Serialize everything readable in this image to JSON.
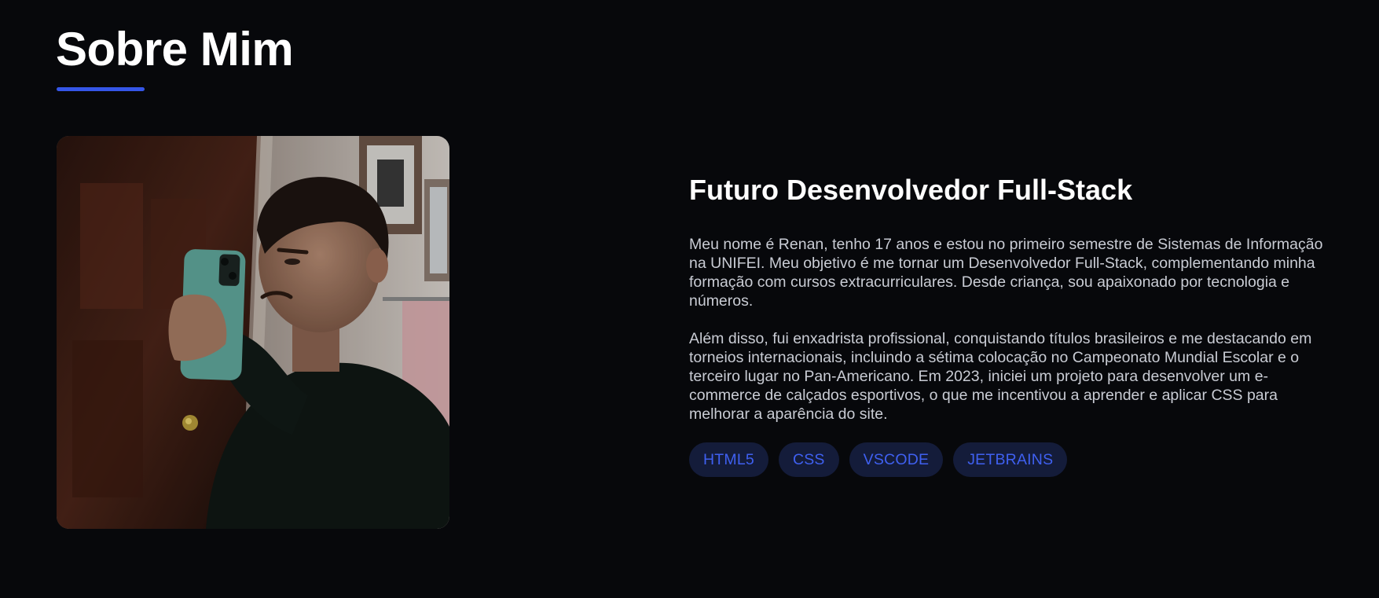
{
  "section": {
    "title": "Sobre Mim",
    "accent_color": "#3556e8"
  },
  "photo": {
    "description_icon": "profile-photo"
  },
  "about": {
    "heading": "Futuro Desenvolvedor Full-Stack",
    "paragraphs": [
      "Meu nome é Renan, tenho 17 anos e estou no primeiro semestre de Sistemas de Informação na UNIFEI. Meu objetivo é me tornar um Desenvolvedor Full-Stack, complementando minha formação com cursos extracurriculares. Desde criança, sou apaixonado por tecnologia e números.",
      "Além disso, fui enxadrista profissional, conquistando títulos brasileiros e me destacando em torneios internacionais, incluindo a sétima colocação no Campeonato Mundial Escolar e o terceiro lugar no Pan-Americano. Em 2023, iniciei um projeto para desenvolver um e-commerce de calçados esportivos, o que me incentivou a aprender e aplicar CSS para melhorar a aparência do site."
    ],
    "tags": [
      "HTML5",
      "CSS",
      "VSCODE",
      "JETBRAINS"
    ],
    "tag_text_color": "#3f60f0",
    "tag_bg_color": "#141c3a"
  }
}
